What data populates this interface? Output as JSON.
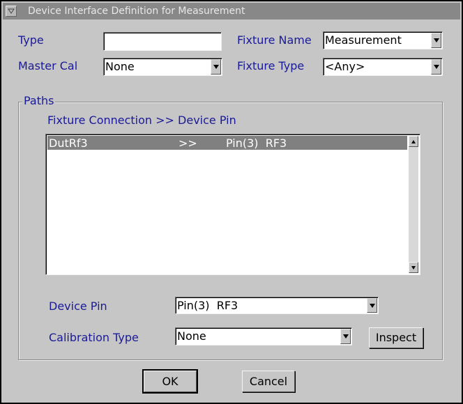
{
  "window": {
    "title": "Device Interface Definition for Measurement"
  },
  "form": {
    "type_label": "Type",
    "type_value": "",
    "fixture_name_label": "Fixture Name",
    "fixture_name_value": "Measurement",
    "master_cal_label": "Master Cal",
    "master_cal_value": "None",
    "fixture_type_label": "Fixture Type",
    "fixture_type_value": "<Any>"
  },
  "paths": {
    "legend": "Paths",
    "header": "Fixture Connection >> Device Pin",
    "rows": [
      {
        "connection": "DutRf3",
        "arrow": ">>",
        "pin": "Pin(3)  RF3"
      }
    ],
    "device_pin_label": "Device Pin",
    "device_pin_value": "Pin(3)  RF3",
    "calibration_type_label": "Calibration Type",
    "calibration_type_value": "None",
    "inspect_label": "Inspect"
  },
  "buttons": {
    "ok": "OK",
    "cancel": "Cancel"
  },
  "icons": {
    "window_menu": "window-menu-icon",
    "dropdown": "chevron-down-icon"
  }
}
